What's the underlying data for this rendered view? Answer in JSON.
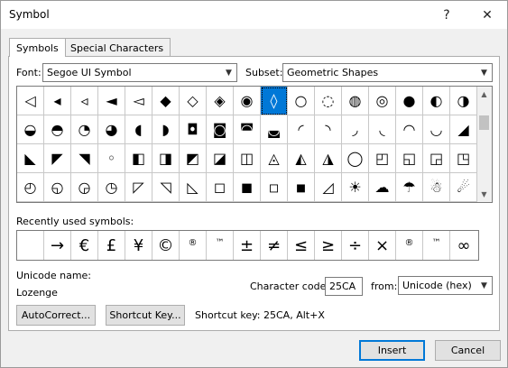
{
  "window": {
    "title": "Symbol",
    "help_label": "?",
    "close_label": "✕"
  },
  "tabs": [
    {
      "label": "Symbols",
      "active": true
    },
    {
      "label": "Special Characters",
      "active": false
    }
  ],
  "font": {
    "label": "Font:",
    "value": "Segoe UI Symbol"
  },
  "subset": {
    "label": "Subset:",
    "value": "Geometric Shapes"
  },
  "symbol_grid": {
    "selected_index": 9,
    "rows": [
      [
        "◁",
        "◂",
        "◃",
        "◄",
        "◅",
        "◆",
        "◇",
        "◈",
        "◉",
        "◊",
        "○",
        "◌",
        "◍",
        "◎",
        "●",
        "◐",
        "◑"
      ],
      [
        "◒",
        "◓",
        "◔",
        "◕",
        "◖",
        "◗",
        "◘",
        "◙",
        "◚",
        "◛",
        "◜",
        "◝",
        "◞",
        "◟",
        "◠",
        "◡",
        "◢"
      ],
      [
        "◣",
        "◤",
        "◥",
        "◦",
        "◧",
        "◨",
        "◩",
        "◪",
        "◫",
        "◬",
        "◭",
        "◮",
        "◯",
        "◰",
        "◱",
        "◲",
        "◳"
      ],
      [
        "◴",
        "◵",
        "◶",
        "◷",
        "◸",
        "◹",
        "◺",
        "◻",
        "◼",
        "◽",
        "◾",
        "◿",
        "☀",
        "☁",
        "☂",
        "☃",
        "☄"
      ]
    ]
  },
  "recent": {
    "label": "Recently used symbols:",
    "symbols": [
      " ",
      "→",
      "€",
      "£",
      "¥",
      "©",
      "®",
      "™",
      "±",
      "≠",
      "≤",
      "≥",
      "÷",
      "×",
      "®",
      "™",
      "∞"
    ]
  },
  "unicode": {
    "name_label": "Unicode name:",
    "name_value": "Lozenge"
  },
  "character_code": {
    "label": "Character code:",
    "value": "25CA"
  },
  "from": {
    "label": "from:",
    "value": "Unicode (hex)"
  },
  "buttons": {
    "autocorrect": "AutoCorrect...",
    "shortcut_key": "Shortcut Key...",
    "insert": "Insert",
    "cancel": "Cancel"
  },
  "shortcut_text": "Shortcut key: 25CA, Alt+X"
}
